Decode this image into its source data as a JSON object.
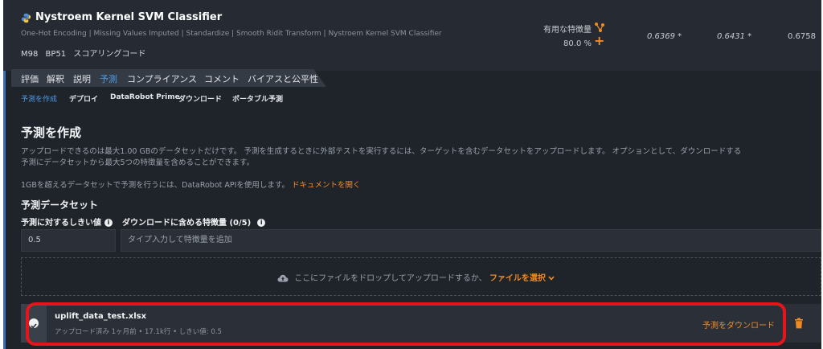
{
  "model": {
    "title": "Nystroem Kernel SVM Classifier",
    "blueprint": "One-Hot Encoding | Missing Values Imputed | Standardize | Smooth Ridit Transform | Nystroem Kernel SVM Classifier",
    "badges": [
      "M98",
      "BP51",
      "スコアリングコード"
    ],
    "feature_label": "有用な特徴量",
    "feature_pct": "80.0 %",
    "scores": [
      "0.6369 *",
      "0.6431 *",
      "0.6758"
    ]
  },
  "tabs": [
    "評価",
    "解釈",
    "説明",
    "予測",
    "コンプライアンス",
    "コメント",
    "バイアスと公平性"
  ],
  "subtabs": [
    "予測を作成",
    "デプロイ",
    "DataRobot Prime",
    "ダウンロード",
    "ポータブル予測"
  ],
  "content": {
    "title": "予測を作成",
    "para1": "アップロードできるのは最大1.00 GBのデータセットだけです。 予測を生成するときに外部テストを実行するには、ターゲットを含むデータセットをアップロードします。 オプションとして、ダウンロードする",
    "para2": "予測にデータセットから最大5つの特徴量を含めることができます。",
    "para3": "1GBを超えるデータセットで予測を行うには、DataRobot APIを使用します。",
    "doc_link": "ドキュメントを開く",
    "dataset_title": "予測データセット",
    "threshold_label": "予測に対するしきい値",
    "features_label": "ダウンロードに含める特徴量 (0/5)",
    "threshold_value": "0.5",
    "features_placeholder": "タイプ入力して特徴量を追加",
    "drop_text": "ここにファイルをドロップしてアップロードするか、",
    "choose_file": "ファイルを選択"
  },
  "file": {
    "name": "uplift_data_test.xlsx",
    "meta": "アップロード済み 1ヶ月前 • 17.1k行 • しきい値: 0.5",
    "download": "予測をダウンロード"
  },
  "colors": {
    "accent": "#f08a24",
    "active_tab": "#4d9ae5",
    "highlight": "#e8141c"
  },
  "icons": [
    "python-icon",
    "feature-network-icon",
    "plus-icon",
    "info-icon",
    "cloud-upload-icon",
    "chevron-down-icon",
    "check-icon",
    "trash-icon"
  ]
}
